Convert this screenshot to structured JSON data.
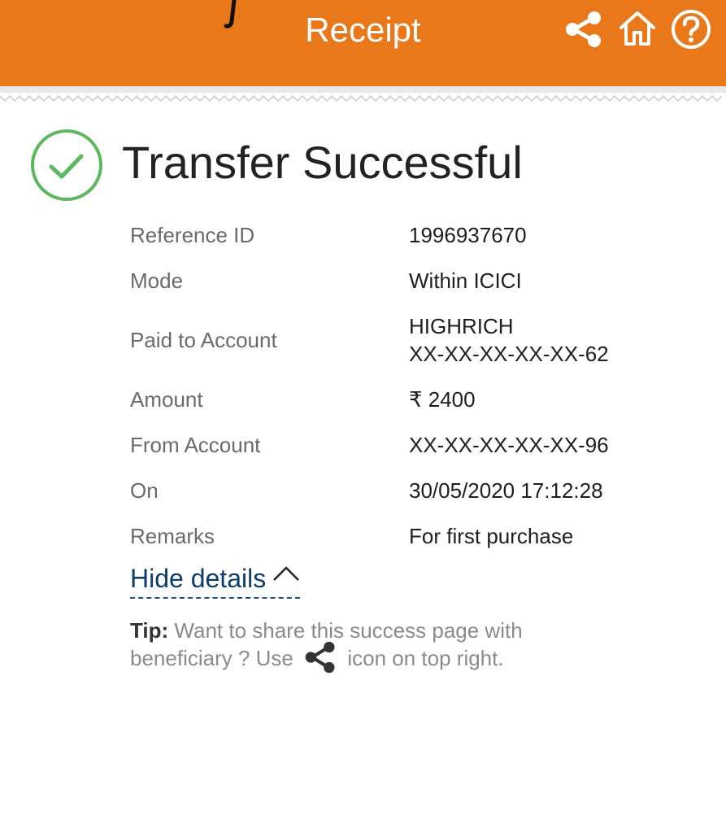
{
  "header": {
    "title": "Receipt",
    "background_color": "#e8781a",
    "icons": [
      "share-icon",
      "home-icon",
      "help-icon"
    ]
  },
  "status": {
    "title": "Transfer Successful",
    "icon": "check-circle-icon",
    "icon_color": "#5cb85c"
  },
  "details": [
    {
      "label": "Reference ID",
      "value": "1996937670"
    },
    {
      "label": "Mode",
      "value": "Within ICICI"
    },
    {
      "label": "Paid to Account",
      "value": "HIGHRICH\nXX-XX-XX-XX-XX-62"
    },
    {
      "label": "Amount",
      "value": "₹ 2400"
    },
    {
      "label": "From Account",
      "value": "XX-XX-XX-XX-XX-96"
    },
    {
      "label": "On",
      "value": "30/05/2020 17:12:28"
    },
    {
      "label": "Remarks",
      "value": "For first purchase"
    }
  ],
  "toggle": {
    "label": "Hide details",
    "link_color": "#0d3d6b"
  },
  "tip": {
    "label": "Tip:",
    "text_before": "Want to share this success page with beneficiary ? Use",
    "text_after": "icon on top right.",
    "icon": "share-icon"
  }
}
